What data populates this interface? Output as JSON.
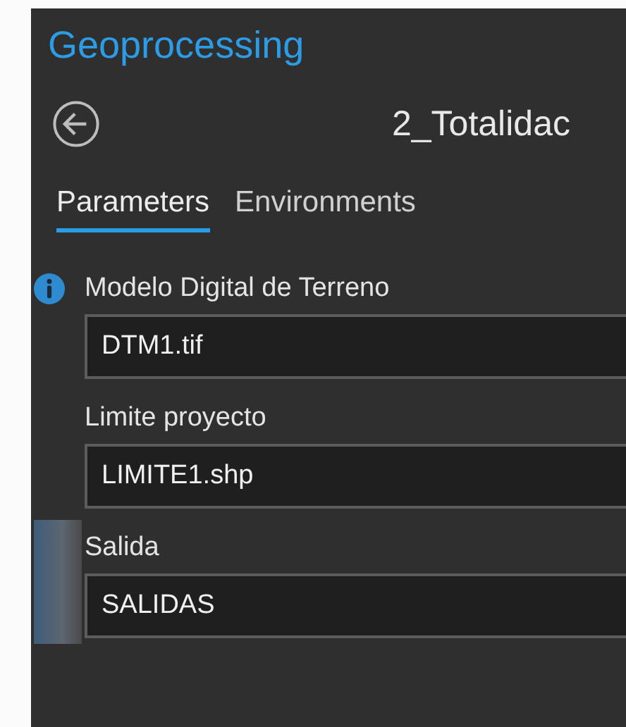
{
  "pane": {
    "title": "Geoprocessing"
  },
  "tool": {
    "name": "2_Totalidac"
  },
  "tabs": [
    {
      "label": "Parameters",
      "selected": true
    },
    {
      "label": "Environments",
      "selected": false
    }
  ],
  "parameters": [
    {
      "label": "Modelo Digital de Terreno",
      "value": "DTM1.tif",
      "info": true,
      "selected": false
    },
    {
      "label": "Limite proyecto",
      "value": "LIMITE1.shp",
      "info": false,
      "selected": false
    },
    {
      "label": "Salida",
      "value": "SALIDAS",
      "info": false,
      "selected": true
    }
  ]
}
